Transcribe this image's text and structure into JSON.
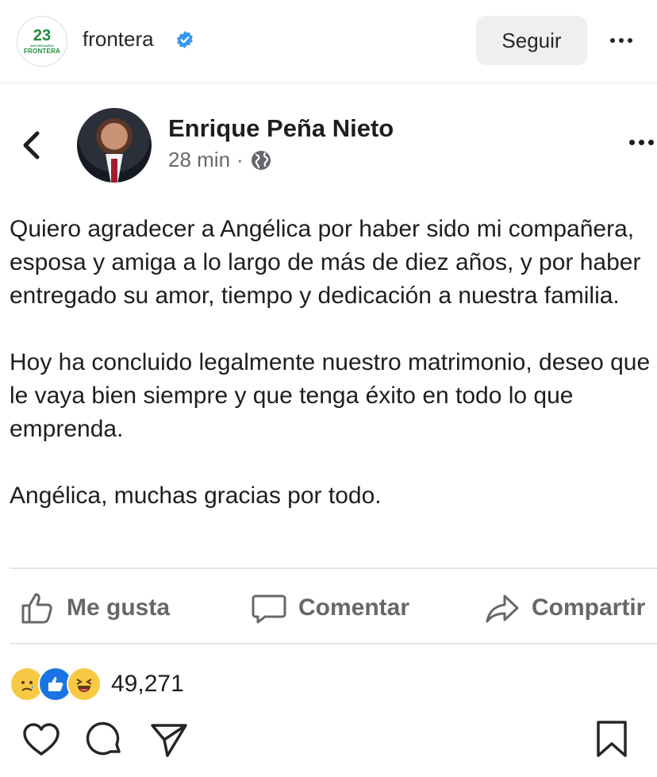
{
  "instagram": {
    "logo": {
      "number": "23",
      "small_text": "ANIVERSARIO",
      "brand": "FRONTERA"
    },
    "username": "frontera",
    "verified_icon": "verified-badge-icon",
    "follow_label": "Seguir",
    "more_icon": "more-horizontal-icon",
    "bottom_icons": [
      "heart-icon",
      "comment-icon",
      "share-send-icon",
      "bookmark-icon"
    ]
  },
  "fb_post": {
    "back_icon": "chevron-left-icon",
    "author": "Enrique Peña Nieto",
    "time": "28 min",
    "separator": "·",
    "privacy_icon": "globe-icon",
    "paragraphs": [
      "Quiero agradecer a Angélica por haber sido mi compañera, esposa y amiga a lo largo de más de diez años, y por haber entregado su amor, tiempo y dedicación a nuestra familia.",
      "Hoy ha concluido legalmente nuestro matrimonio, deseo que le vaya bien siempre y que tenga éxito en todo lo que emprenda.",
      "Angélica, muchas gracias por todo."
    ],
    "actions": {
      "like": "Me gusta",
      "comment": "Comentar",
      "share": "Compartir"
    },
    "reactions": {
      "icons": [
        "sad-reaction-icon",
        "like-reaction-icon",
        "haha-reaction-icon"
      ],
      "count": "49,271"
    }
  },
  "colors": {
    "verified": "#3897f0",
    "fb_like": "#1b74e4",
    "green_brand": "#1f8a3b",
    "muted": "#65676b"
  }
}
